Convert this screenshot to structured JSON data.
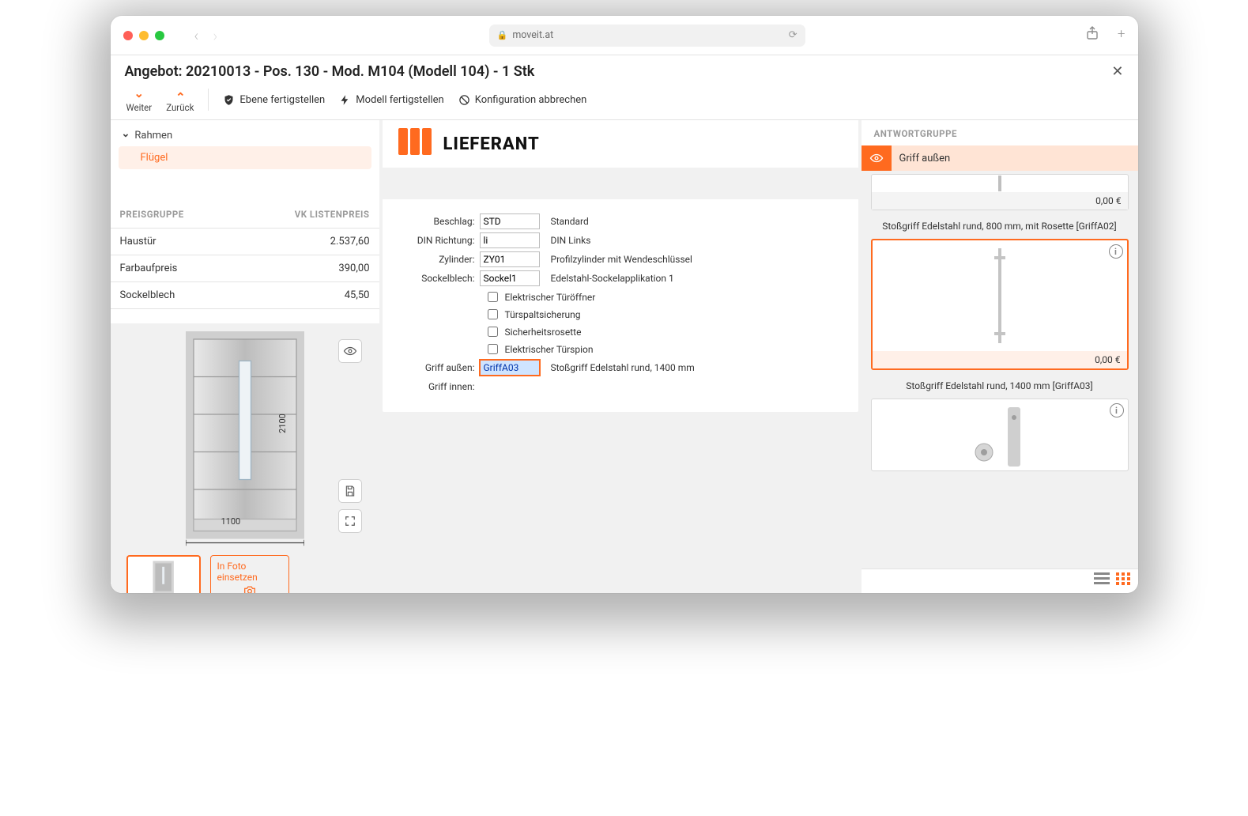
{
  "browser": {
    "url_host": "moveit.at"
  },
  "header": {
    "title": "Angebot: 20210013 - Pos. 130 - Mod. M104 (Modell 104) - 1 Stk"
  },
  "toolbar": {
    "weiter": "Weiter",
    "zurueck": "Zurück",
    "ebene": "Ebene fertigstellen",
    "modell": "Modell fertigstellen",
    "abbrechen": "Konfiguration abbrechen"
  },
  "nav": {
    "root": "Rahmen",
    "child": "Flügel"
  },
  "pricegroup": {
    "head_a": "PREISGRUPPE",
    "head_b": "VK LISTENPREIS",
    "rows": [
      {
        "a": "Haustür",
        "b": "2.537,60"
      },
      {
        "a": "Farbaufpreis",
        "b": "390,00"
      },
      {
        "a": "Sockelblech",
        "b": "45,50"
      }
    ]
  },
  "preview": {
    "height_dim": "2100",
    "width_dim": "1100",
    "foto_btn": "In Foto einsetzen"
  },
  "brand": {
    "name": "LIEFERANT"
  },
  "form": {
    "fields": [
      {
        "label": "Beschlag:",
        "value": "STD",
        "desc": "Standard"
      },
      {
        "label": "DIN Richtung:",
        "value": "li",
        "desc": "DIN Links"
      },
      {
        "label": "Zylinder:",
        "value": "ZY01",
        "desc": "Profilzylinder mit Wendeschlüssel"
      },
      {
        "label": "Sockelblech:",
        "value": "Sockel1",
        "desc": "Edelstahl-Sockelapplikation 1"
      }
    ],
    "checks": [
      {
        "label": "Elektrischer Türöffner",
        "checked": false
      },
      {
        "label": "Türspaltsicherung",
        "checked": false
      },
      {
        "label": "Sicherheitsrosette",
        "checked": false
      },
      {
        "label": "Elektrischer Türspion",
        "checked": false
      }
    ],
    "griff_aussen": {
      "label": "Griff außen:",
      "value": "GriffA03",
      "desc": "Stoßgriff Edelstahl rund, 1400 mm"
    },
    "griff_innen": {
      "label": "Griff innen:",
      "value": ""
    }
  },
  "answergroup": {
    "title": "ANTWORTGRUPPE",
    "banner": "Griff außen",
    "items": [
      {
        "price": "0,00 €",
        "label": "Stoßgriff Edelstahl rund, 800 mm, mit Rosette [GriffA02]",
        "selected": false,
        "stub": true
      },
      {
        "price": "0,00 €",
        "label": "Stoßgriff Edelstahl rund, 1400 mm [GriffA03]",
        "selected": true,
        "variant": "handle-long"
      },
      {
        "price": "",
        "label": "",
        "selected": false,
        "variant": "lever-plate",
        "show_price": false
      }
    ]
  }
}
